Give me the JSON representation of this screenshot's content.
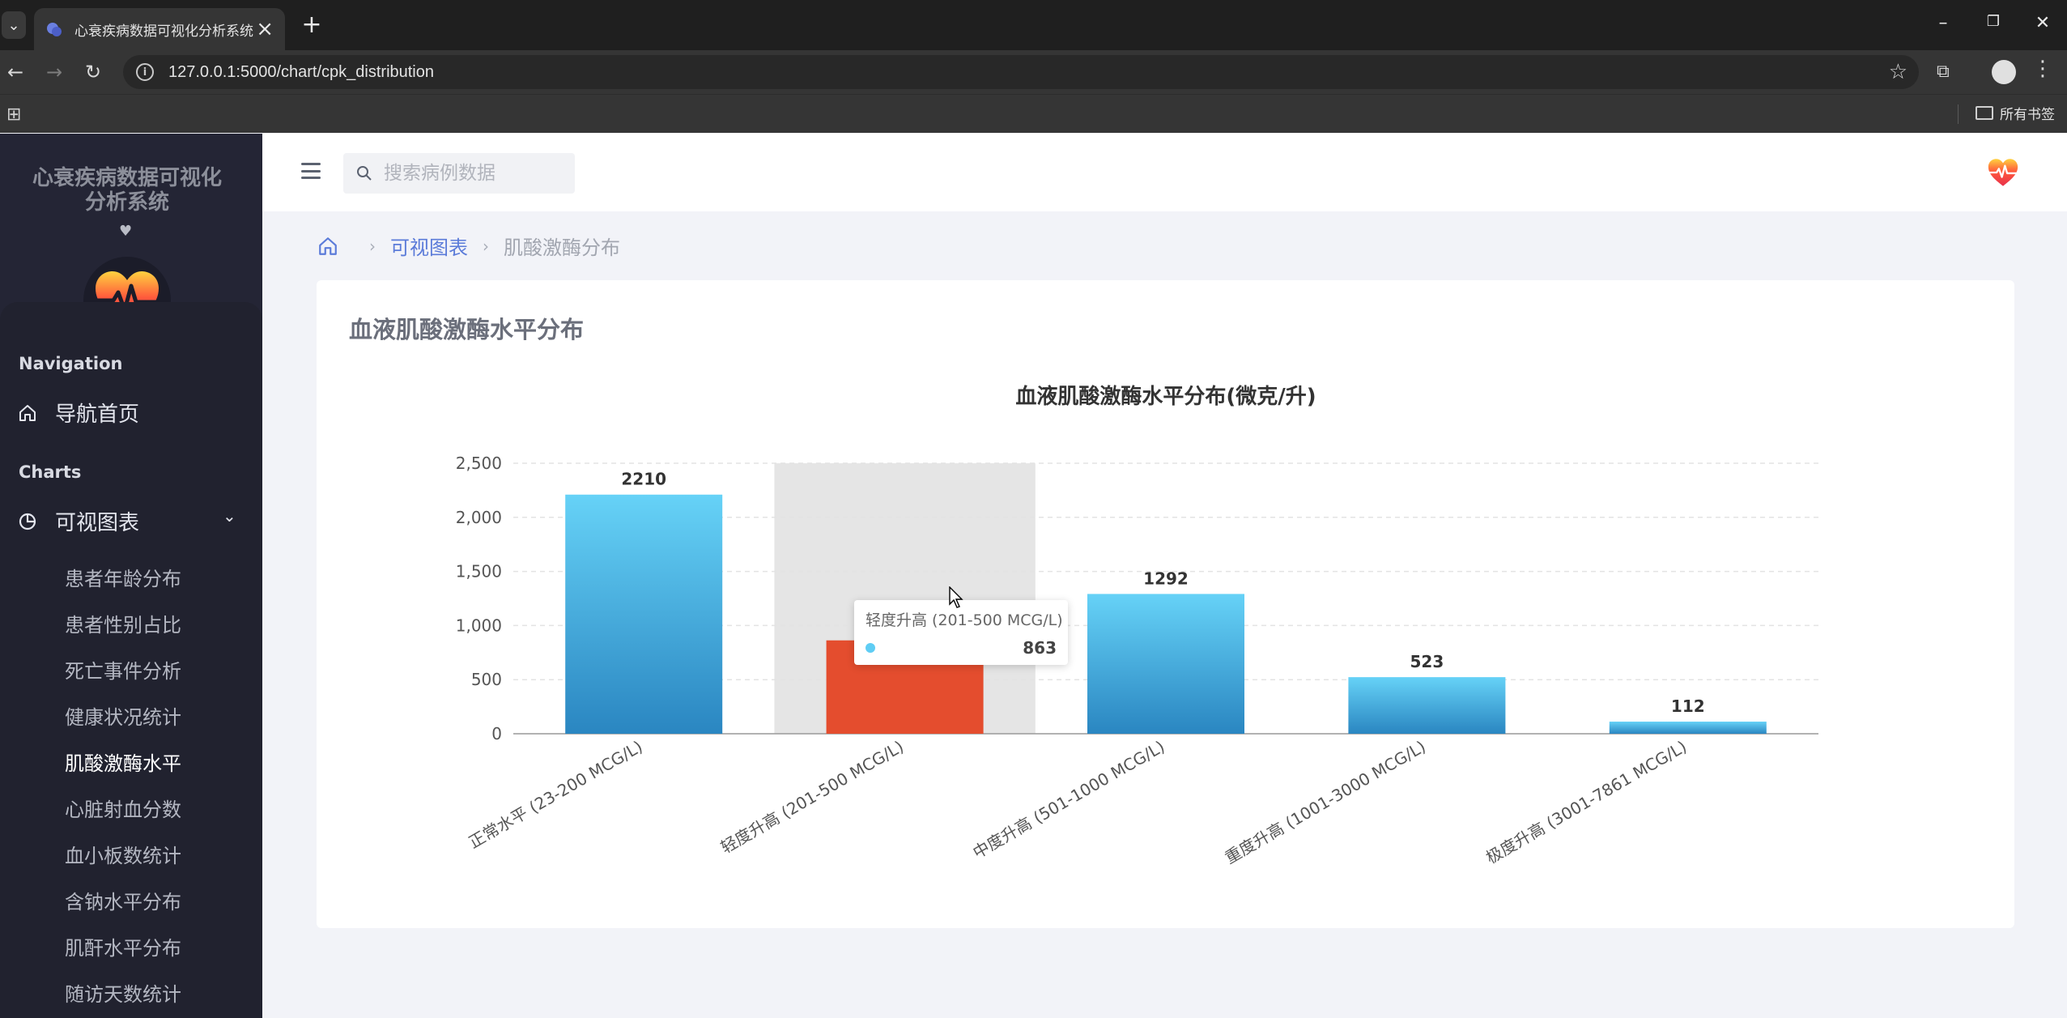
{
  "browser": {
    "tab_title": "心衰疾病数据可视化分析系统",
    "url": "127.0.0.1:5000/chart/cpk_distribution",
    "bookmarks_all": "所有书签"
  },
  "sidebar": {
    "brand_title": "心衰疾病数据可视化分析系统",
    "section_navigation": "Navigation",
    "home_label": "导航首页",
    "section_charts": "Charts",
    "charts_label": "可视图表",
    "sub_items": [
      "患者年龄分布",
      "患者性别占比",
      "死亡事件分析",
      "健康状况统计",
      "肌酸激酶水平",
      "心脏射血分数",
      "血小板数统计",
      "含钠水平分布",
      "肌酐水平分布",
      "随访天数统计"
    ],
    "active_item": "肌酸激酶水平"
  },
  "topbar": {
    "search_placeholder": "搜索病例数据"
  },
  "breadcrumb": {
    "link": "可视图表",
    "current": "肌酸激酶分布"
  },
  "card": {
    "title": "血液肌酸激酶水平分布"
  },
  "chart_data": {
    "type": "bar",
    "title": "血液肌酸激酶水平分布(微克/升)",
    "categories": [
      "正常水平 (23-200 MCG/L)",
      "轻度升高 (201-500 MCG/L)",
      "中度升高 (501-1000 MCG/L)",
      "重度升高 (1001-3000 MCG/L)",
      "极度升高 (3001-7861 MCG/L)"
    ],
    "values": [
      2210,
      863,
      1292,
      523,
      112
    ],
    "ylim": [
      0,
      2500
    ],
    "yticks": [
      0,
      500,
      1000,
      1500,
      2000,
      2500
    ],
    "ytick_labels": [
      "0",
      "500",
      "1,000",
      "1,500",
      "2,000",
      "2,500"
    ],
    "grid": true,
    "highlighted_index": 1,
    "colors": {
      "bar_top": "#66d2f7",
      "bar_bottom": "#2a86c1",
      "highlight": "#e44d2e",
      "hover_band": "#e5e5e5"
    }
  },
  "tooltip": {
    "title": "轻度升高 (201-500 MCG/L)",
    "value": "863"
  }
}
